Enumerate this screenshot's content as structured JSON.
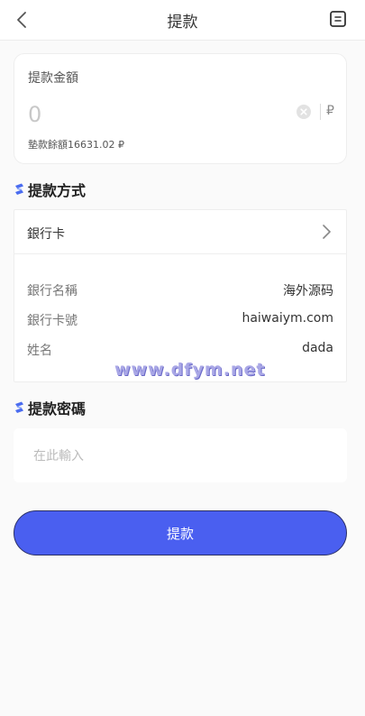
{
  "header": {
    "title": "提款",
    "back_icon": "chevron-left-icon",
    "record_icon": "document-icon"
  },
  "amount": {
    "label": "提款金額",
    "value": "",
    "placeholder": "0",
    "currency": "₽",
    "balance_text": "墊款餘額16631.02 ₽"
  },
  "method": {
    "section_title": "提款方式",
    "selected": "銀行卡",
    "rows": [
      {
        "key": "銀行名稱",
        "value": "海外源码"
      },
      {
        "key": "銀行卡號",
        "value": "haiwaiym.com"
      },
      {
        "key": "姓名",
        "value": "dada"
      }
    ]
  },
  "watermark": "www.dfym.net",
  "password": {
    "section_title": "提款密碼",
    "placeholder": "在此輸入"
  },
  "submit_label": "提款",
  "colors": {
    "accent": "#4a5ff0",
    "section_icon": "#4a6cf0",
    "page_bg": "#fafafa"
  }
}
